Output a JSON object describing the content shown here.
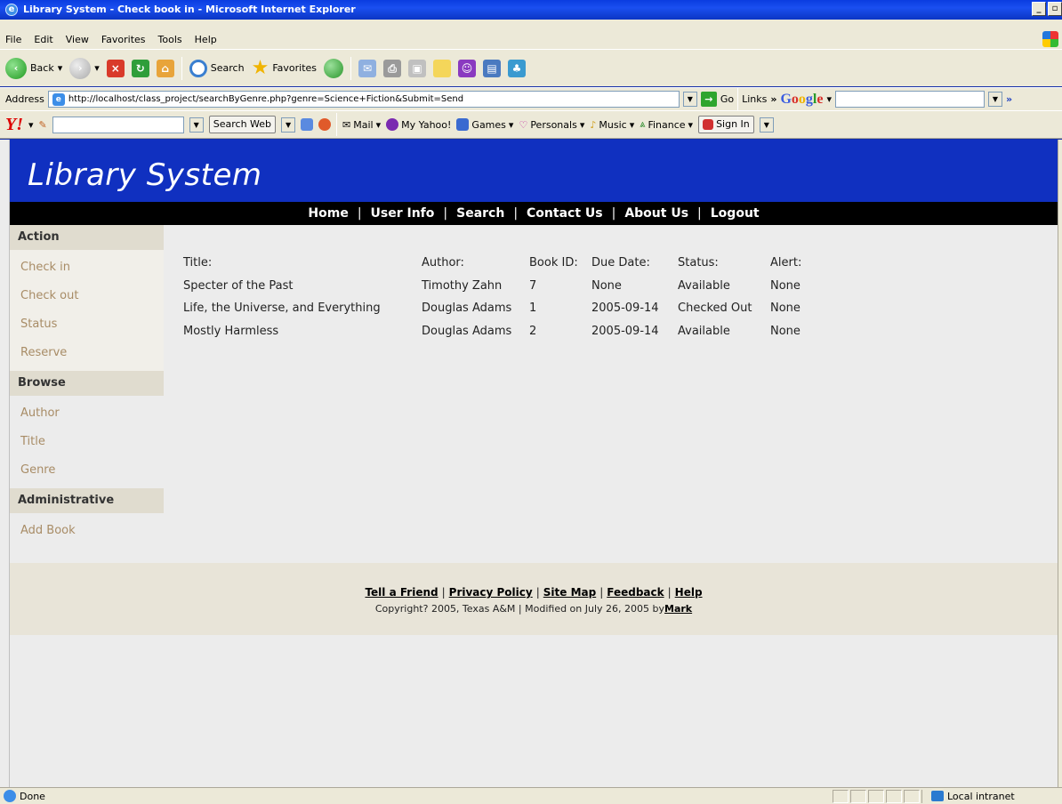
{
  "window": {
    "title": "Library System - Check book in - Microsoft Internet Explorer",
    "min_btn": "_",
    "max_btn": "▫",
    "close_btn": "x"
  },
  "menu": [
    "File",
    "Edit",
    "View",
    "Favorites",
    "Tools",
    "Help"
  ],
  "toolbar": {
    "back": "Back",
    "search": "Search",
    "favorites": "Favorites"
  },
  "address": {
    "label": "Address",
    "url": "http://localhost/class_project/searchByGenre.php?genre=Science+Fiction&Submit=Send",
    "go": "Go",
    "links": "Links",
    "google": "Google"
  },
  "yahoo": {
    "search_web": "Search Web",
    "mail": "Mail",
    "my_yahoo": "My Yahoo!",
    "games": "Games",
    "personals": "Personals",
    "music": "Music",
    "finance": "Finance",
    "sign_in": "Sign In"
  },
  "site": {
    "title": "Library System",
    "nav": [
      "Home",
      "User Info",
      "Search",
      "Contact Us",
      "About Us",
      "Logout"
    ]
  },
  "sidebar": {
    "sections": [
      {
        "heading": "Action",
        "items": [
          "Check in",
          "Check out",
          "Status",
          "Reserve"
        ]
      },
      {
        "heading": "Browse",
        "items": [
          "Author",
          "Title",
          "Genre"
        ]
      },
      {
        "heading": "Administrative",
        "items": [
          "Add Book"
        ]
      }
    ]
  },
  "results": {
    "headers": [
      "Title:",
      "Author:",
      "Book ID:",
      "Due Date:",
      "Status:",
      "Alert:"
    ],
    "rows": [
      [
        "Specter of the Past",
        "Timothy Zahn",
        "7",
        "None",
        "Available",
        "None"
      ],
      [
        "Life, the Universe, and Everything",
        "Douglas Adams",
        "1",
        "2005-09-14",
        "Checked Out",
        "None"
      ],
      [
        "Mostly Harmless",
        "Douglas Adams",
        "2",
        "2005-09-14",
        "Available",
        "None"
      ]
    ]
  },
  "footer": {
    "links": [
      "Tell a Friend",
      "Privacy Policy",
      "Site Map",
      "Feedback",
      "Help"
    ],
    "copyright_text": "Copyright? 2005, Texas A&M | Modified on July 26, 2005 by",
    "author_link": "Mark"
  },
  "status": {
    "text": "Done",
    "zone": "Local intranet"
  }
}
